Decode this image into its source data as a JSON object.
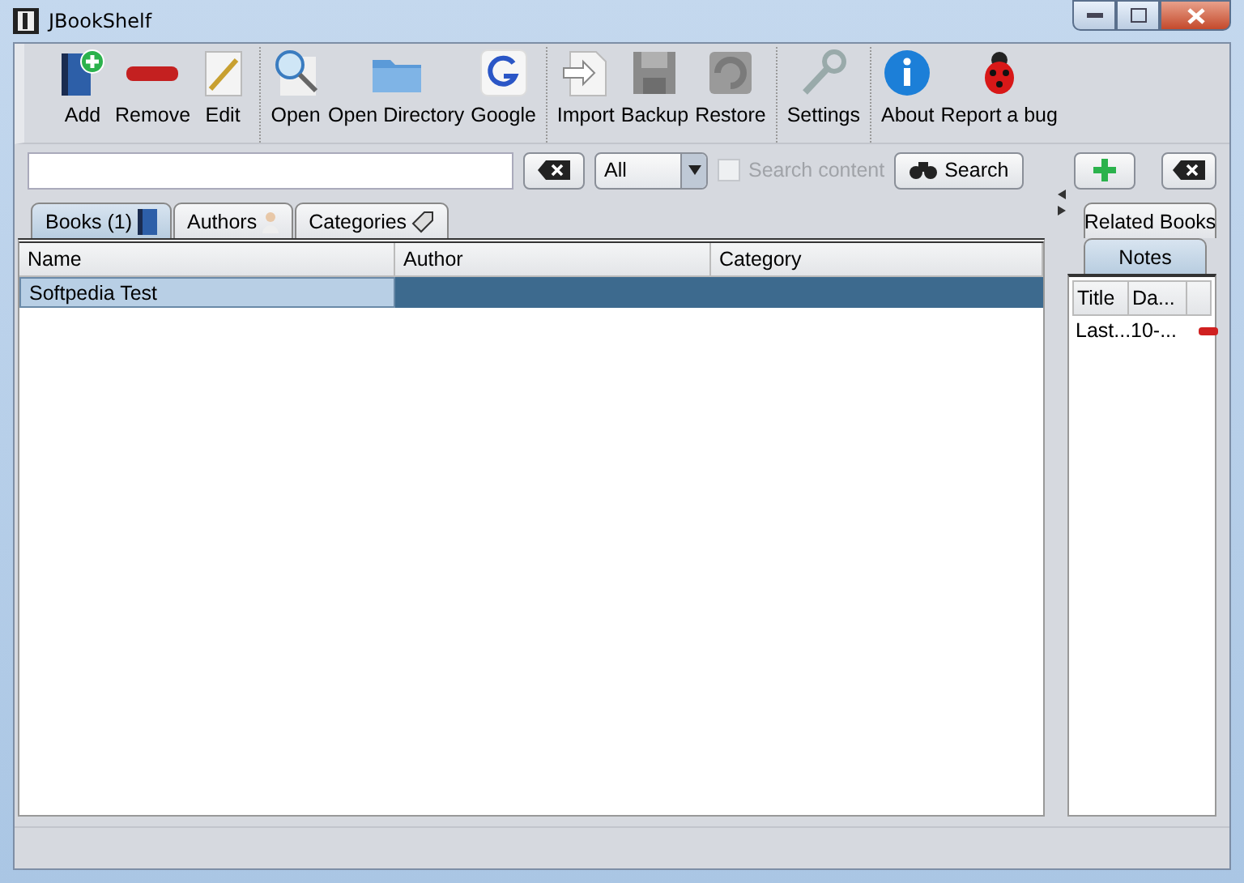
{
  "window": {
    "title": "JBookShelf"
  },
  "toolbar": {
    "groups": [
      [
        {
          "label": "Add"
        },
        {
          "label": "Remove"
        },
        {
          "label": "Edit"
        }
      ],
      [
        {
          "label": "Open"
        },
        {
          "label": "Open Directory"
        },
        {
          "label": "Google"
        }
      ],
      [
        {
          "label": "Import"
        },
        {
          "label": "Backup"
        },
        {
          "label": "Restore"
        }
      ],
      [
        {
          "label": "Settings"
        }
      ],
      [
        {
          "label": "About"
        },
        {
          "label": "Report a bug"
        }
      ]
    ]
  },
  "search": {
    "filter": "All",
    "search_content": {
      "label": "Search content",
      "checked": false,
      "disabled": true
    },
    "button": "Search"
  },
  "tabs": [
    {
      "label": "Books (1)",
      "selected": true
    },
    {
      "label": "Authors",
      "selected": false
    },
    {
      "label": "Categories",
      "selected": false
    }
  ],
  "table": {
    "columns": [
      "Name",
      "Author",
      "Category"
    ],
    "rows": [
      {
        "cells": [
          "Softpedia Test",
          "",
          ""
        ],
        "selected": true
      }
    ]
  },
  "side_panel": {
    "tabs": [
      {
        "label": "Related Books",
        "selected": false
      },
      {
        "label": "Notes",
        "selected": true
      }
    ],
    "columns": [
      "Title",
      "Da..."
    ],
    "rows": [
      {
        "cells": [
          "Last...",
          "10-..."
        ]
      }
    ]
  }
}
